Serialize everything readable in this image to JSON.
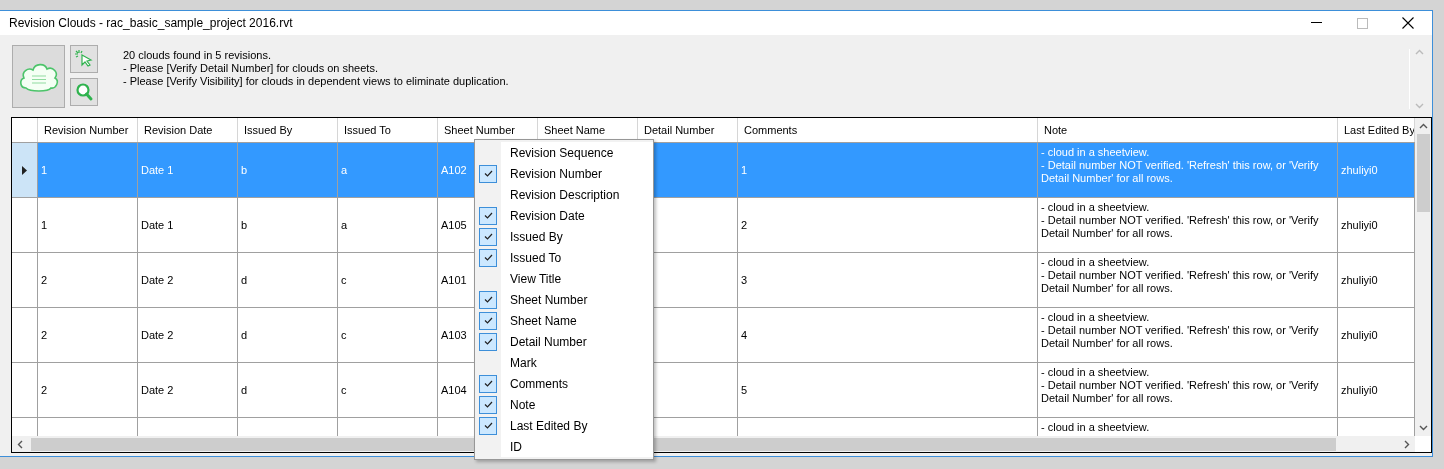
{
  "window": {
    "title": "Revision Clouds - rac_basic_sample_project 2016.rvt"
  },
  "toolbar": {
    "messages": [
      "20 clouds found in 5 revisions.",
      "- Please [Verify Detail Number] for clouds on sheets.",
      "- Please [Verify Visibility] for clouds in dependent views to eliminate duplication."
    ]
  },
  "table": {
    "columns": [
      "Revision Number",
      "Revision Date",
      "Issued By",
      "Issued To",
      "Sheet Number",
      "Sheet Name",
      "Detail Number",
      "Comments",
      "Note",
      "Last Edited By"
    ],
    "rows": [
      {
        "selected": true,
        "cells": [
          "1",
          "Date 1",
          "b",
          "a",
          "A102",
          null,
          null,
          "1",
          "- cloud in a sheetview.\n- Detail number NOT verified. 'Refresh' this row, or 'Verify\nDetail Number' for all rows.",
          "zhuliyi0"
        ]
      },
      {
        "selected": false,
        "cells": [
          "1",
          "Date 1",
          "b",
          "a",
          "A105",
          null,
          null,
          "2",
          "- cloud in a sheetview.\n- Detail number NOT verified. 'Refresh' this row, or 'Verify\nDetail Number' for all rows.",
          "zhuliyi0"
        ]
      },
      {
        "selected": false,
        "cells": [
          "2",
          "Date 2",
          "d",
          "c",
          "A101",
          null,
          null,
          "3",
          "- cloud in a sheetview.\n- Detail number NOT verified. 'Refresh' this row, or 'Verify\nDetail Number' for all rows.",
          "zhuliyi0"
        ]
      },
      {
        "selected": false,
        "cells": [
          "2",
          "Date 2",
          "d",
          "c",
          "A103",
          null,
          null,
          "4",
          "- cloud in a sheetview.\n- Detail number NOT verified. 'Refresh' this row, or 'Verify\nDetail Number' for all rows.",
          "zhuliyi0"
        ]
      },
      {
        "selected": false,
        "cells": [
          "2",
          "Date 2",
          "d",
          "c",
          "A104",
          null,
          null,
          "5",
          "- cloud in a sheetview.\n- Detail number NOT verified. 'Refresh' this row, or 'Verify\nDetail Number' for all rows.",
          "zhuliyi0"
        ]
      },
      {
        "selected": false,
        "cells": [
          null,
          null,
          null,
          null,
          null,
          null,
          null,
          null,
          "- cloud in a sheetview.",
          null
        ]
      }
    ]
  },
  "column_menu": {
    "items": [
      {
        "label": "Revision Sequence",
        "checked": false
      },
      {
        "label": "Revision Number",
        "checked": true
      },
      {
        "label": "Revision Description",
        "checked": false
      },
      {
        "label": "Revision Date",
        "checked": true
      },
      {
        "label": "Issued By",
        "checked": true
      },
      {
        "label": "Issued To",
        "checked": true
      },
      {
        "label": "View Title",
        "checked": false
      },
      {
        "label": "Sheet Number",
        "checked": true
      },
      {
        "label": "Sheet Name",
        "checked": true
      },
      {
        "label": "Detail Number",
        "checked": true
      },
      {
        "label": "Mark",
        "checked": false
      },
      {
        "label": "Comments",
        "checked": true
      },
      {
        "label": "Note",
        "checked": true
      },
      {
        "label": "Last Edited By",
        "checked": true
      },
      {
        "label": "ID",
        "checked": false
      }
    ]
  }
}
